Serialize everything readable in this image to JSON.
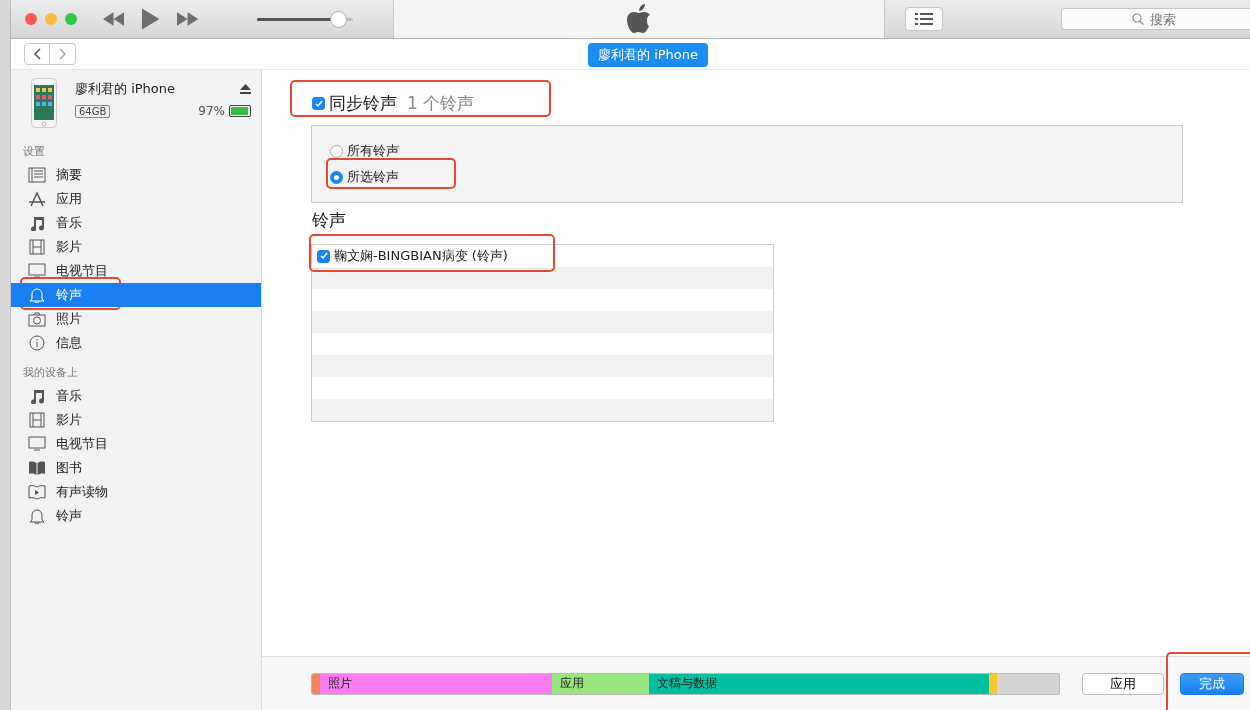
{
  "toolbar": {
    "volume": {
      "level": 0.9
    },
    "search": {
      "placeholder": "搜索"
    }
  },
  "device_tab": {
    "label": "廖利君的 iPhone"
  },
  "device": {
    "name": "廖利君的 iPhone",
    "capacity": "64GB",
    "battery": "97%",
    "battery_level": {
      "level": 0.97
    }
  },
  "sidebar": {
    "sections": [
      {
        "title": "设置",
        "items": [
          {
            "label": "摘要",
            "kind": "summary",
            "selected": false,
            "highlighted": false
          },
          {
            "label": "应用",
            "kind": "apps",
            "selected": false,
            "highlighted": false
          },
          {
            "label": "音乐",
            "kind": "music",
            "selected": false,
            "highlighted": false
          },
          {
            "label": "影片",
            "kind": "film",
            "selected": false,
            "highlighted": false
          },
          {
            "label": "电视节目",
            "kind": "tv",
            "selected": false,
            "highlighted": false
          },
          {
            "label": "铃声",
            "kind": "bell",
            "selected": true,
            "highlighted": true
          },
          {
            "label": "照片",
            "kind": "camera",
            "selected": false,
            "highlighted": false
          },
          {
            "label": "信息",
            "kind": "info",
            "selected": false,
            "highlighted": false
          }
        ]
      },
      {
        "title": "我的设备上",
        "items": [
          {
            "label": "音乐",
            "kind": "music",
            "selected": false,
            "highlighted": false
          },
          {
            "label": "影片",
            "kind": "film",
            "selected": false,
            "highlighted": false
          },
          {
            "label": "电视节目",
            "kind": "tv",
            "selected": false,
            "highlighted": false
          },
          {
            "label": "图书",
            "kind": "book",
            "selected": false,
            "highlighted": false
          },
          {
            "label": "有声读物",
            "kind": "audiobook",
            "selected": false,
            "highlighted": false
          },
          {
            "label": "铃声",
            "kind": "bell",
            "selected": false,
            "highlighted": false
          }
        ]
      }
    ]
  },
  "sync": {
    "label": "同步铃声",
    "count": "1 个铃声",
    "checked": true,
    "highlighted": true
  },
  "options": [
    {
      "label": "所有铃声",
      "selected": false,
      "highlighted": false
    },
    {
      "label": "所选铃声",
      "selected": true,
      "highlighted": true
    }
  ],
  "ringtones": {
    "title": "铃声",
    "items": [
      {
        "label": "鞠文娴-BINGBIAN病变 (铃声)",
        "checked": true,
        "highlighted": true
      }
    ]
  },
  "storage": [
    {
      "color": "#f0845a"
    },
    {
      "label": "照片",
      "color": "#fb7cf0"
    },
    {
      "label": "应用",
      "color": "#98e47e"
    },
    {
      "label": "文稿与数据",
      "color": "#00bf9e"
    },
    {
      "color": "#f7c72c"
    }
  ],
  "buttons": [
    {
      "label": "应用",
      "kind": "plain",
      "highlighted": false
    },
    {
      "label": "完成",
      "kind": "primary",
      "highlighted": true
    }
  ]
}
